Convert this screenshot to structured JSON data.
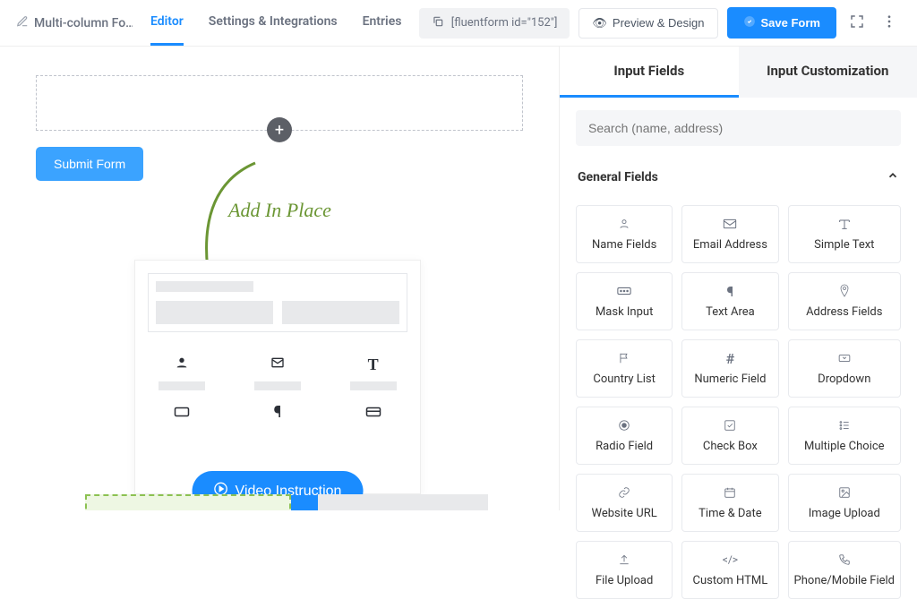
{
  "header": {
    "form_name": "Multi-column Fo…",
    "tabs": [
      "Editor",
      "Settings & Integrations",
      "Entries"
    ],
    "shortcode": "[fluentform id=\"152\"]",
    "preview_label": "Preview & Design",
    "save_label": "Save Form"
  },
  "canvas": {
    "submit_label": "Submit Form",
    "add_in_place": "Add In Place",
    "video_label": "Video Instruction"
  },
  "sidebar": {
    "tabs": [
      "Input Fields",
      "Input Customization"
    ],
    "search_placeholder": "Search (name, address)",
    "section_title": "General Fields",
    "fields": [
      {
        "label": "Name Fields",
        "icon": "person"
      },
      {
        "label": "Email Address",
        "icon": "mail"
      },
      {
        "label": "Simple Text",
        "icon": "text"
      },
      {
        "label": "Mask Input",
        "icon": "mask"
      },
      {
        "label": "Text Area",
        "icon": "paragraph"
      },
      {
        "label": "Address Fields",
        "icon": "pin"
      },
      {
        "label": "Country List",
        "icon": "flag"
      },
      {
        "label": "Numeric Field",
        "icon": "hash"
      },
      {
        "label": "Dropdown",
        "icon": "caret"
      },
      {
        "label": "Radio Field",
        "icon": "radio"
      },
      {
        "label": "Check Box",
        "icon": "check"
      },
      {
        "label": "Multiple Choice",
        "icon": "list"
      },
      {
        "label": "Website URL",
        "icon": "link"
      },
      {
        "label": "Time & Date",
        "icon": "calendar"
      },
      {
        "label": "Image Upload",
        "icon": "image"
      },
      {
        "label": "File Upload",
        "icon": "upload"
      },
      {
        "label": "Custom HTML",
        "icon": "code"
      },
      {
        "label": "Phone/Mobile Field",
        "icon": "phone"
      }
    ]
  },
  "icons": {
    "person": "◯",
    "mail": "✉",
    "text": "T",
    "mask": "▭",
    "paragraph": "¶",
    "pin": "⊙",
    "flag": "⚑",
    "hash": "#",
    "caret": "▾",
    "radio": "◉",
    "check": "☑",
    "list": "☰",
    "link": "⟲",
    "calendar": "📅",
    "image": "▣",
    "upload": "⤒",
    "code": "</>",
    "phone": "✆"
  }
}
